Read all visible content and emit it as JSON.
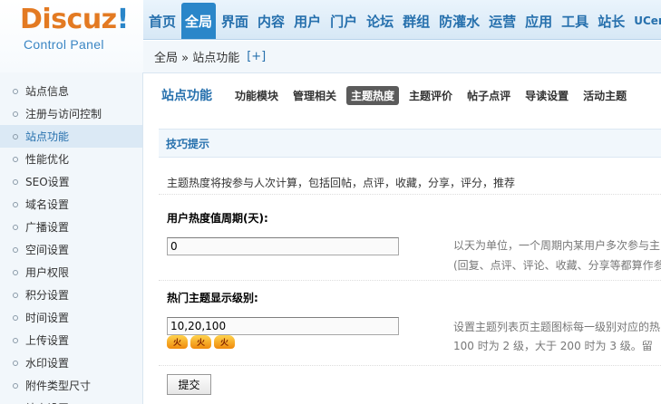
{
  "logo": {
    "brand_main": "Discuz",
    "brand_bang": "!",
    "subtitle": "Control Panel"
  },
  "topnav": [
    "首页",
    "全局",
    "界面",
    "内容",
    "用户",
    "门户",
    "论坛",
    "群组",
    "防灌水",
    "运营",
    "应用",
    "工具",
    "站长",
    "UCen"
  ],
  "topnav_active": "全局",
  "breadcrumb": {
    "path": "全局 » 站点功能",
    "add": "[+]"
  },
  "sidebar": [
    "站点信息",
    "注册与访问控制",
    "站点功能",
    "性能优化",
    "SEO设置",
    "域名设置",
    "广播设置",
    "空间设置",
    "用户权限",
    "积分设置",
    "时间设置",
    "上传设置",
    "水印设置",
    "附件类型尺寸",
    "站点设置"
  ],
  "sidebar_active": "站点功能",
  "content": {
    "title": "站点功能",
    "subtabs": [
      "功能模块",
      "管理相关",
      "主题热度",
      "主题评价",
      "帖子点评",
      "导读设置",
      "活动主题"
    ],
    "subtab_active": "主题热度",
    "tip_title": "技巧提示",
    "tip_text": "主题热度将按参与人次计算，包括回帖，点评，收藏，分享，评分，推荐",
    "field1": {
      "label": "用户热度值周期(天):",
      "value": "0",
      "hint1": "以天为单位，一个周期内某用户多次参与主",
      "hint2": "(回复、点评、评论、收藏、分享等都算作参"
    },
    "field2": {
      "label": "热门主题显示级别:",
      "value": "10,20,100",
      "hint1": "设置主题列表页主题图标每一级别对应的热",
      "hint2": "100 时为 2 级，大于  200 时为 3 级。留"
    },
    "flame_icon_text": "火",
    "submit": "提交"
  }
}
